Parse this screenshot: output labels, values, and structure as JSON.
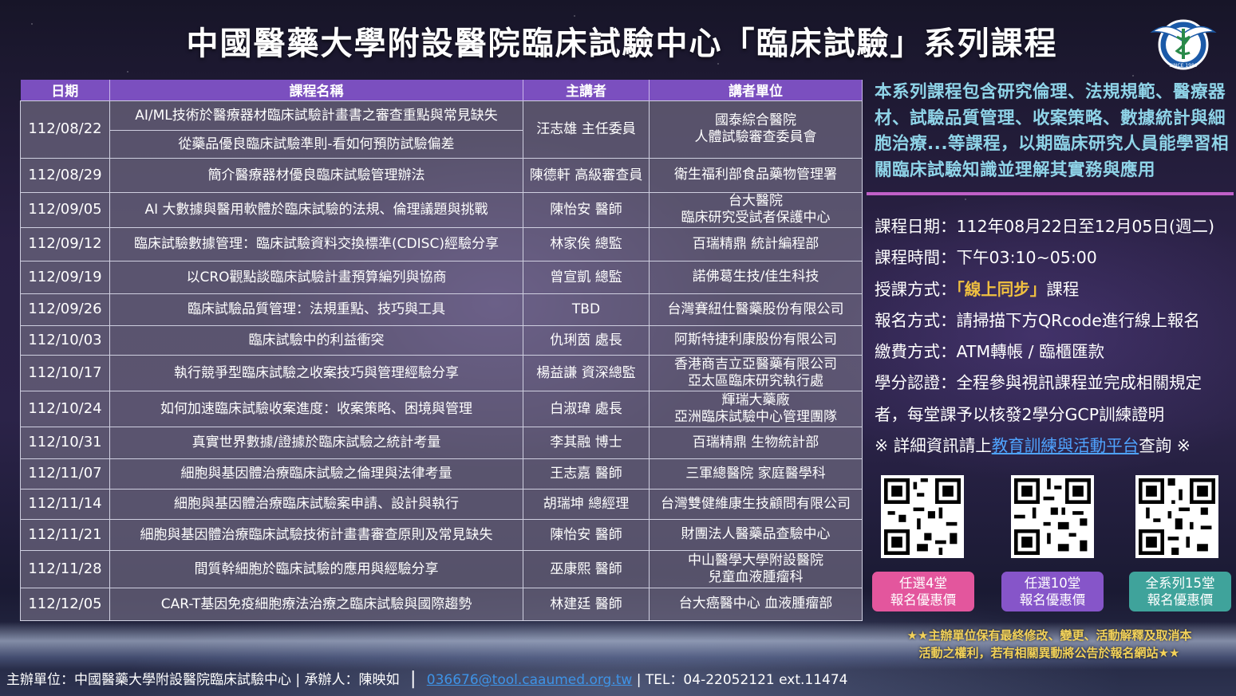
{
  "title": "中國醫藥大學附設醫院臨床試驗中心「臨床試驗」系列課程",
  "logo_text": "SINCE 1980",
  "table": {
    "headers": [
      "日期",
      "課程名稱",
      "主講者",
      "講者單位"
    ],
    "rows": [
      {
        "date": "112/08/22",
        "course": "AI/ML技術於醫療器材臨床試驗計畫書之審查重點與常見缺失",
        "course2": "從藥品優良臨床試驗準則-看如何預防試驗偏差",
        "speaker": "汪志雄 主任委員",
        "unit1": "國泰綜合醫院",
        "unit2": "人體試驗審查委員會"
      },
      {
        "date": "112/08/29",
        "course": "簡介醫療器材優良臨床試驗管理辦法",
        "speaker": "陳德軒 高級審查員",
        "unit1": "衛生福利部食品藥物管理署"
      },
      {
        "date": "112/09/05",
        "course": "AI 大數據與醫用軟體於臨床試驗的法規、倫理議題與挑戰",
        "speaker": "陳怡安 醫師",
        "unit1": "台大醫院",
        "unit2": "臨床研究受試者保護中心"
      },
      {
        "date": "112/09/12",
        "course": "臨床試驗數據管理：臨床試驗資料交換標準(CDISC)經驗分享",
        "speaker": "林家俟 總監",
        "unit1": "百瑞精鼎 統計編程部"
      },
      {
        "date": "112/09/19",
        "course": "以CRO觀點談臨床試驗計畫預算編列與協商",
        "speaker": "曾宣凱 總監",
        "unit1": "諾佛葛生技/佳生科技"
      },
      {
        "date": "112/09/26",
        "course": "臨床試驗品質管理：法規重點、技巧與工具",
        "speaker": "TBD",
        "unit1": "台灣賽紐仕醫藥股份有限公司"
      },
      {
        "date": "112/10/03",
        "course": "臨床試驗中的利益衝突",
        "speaker": "仇琍茵 處長",
        "unit1": "阿斯特捷利康股份有限公司"
      },
      {
        "date": "112/10/17",
        "course": "執行競爭型臨床試驗之收案技巧與管理經驗分享",
        "speaker": "楊益謙 資深總監",
        "unit1": "香港商吉立亞醫藥有限公司",
        "unit2": "亞太區臨床研究執行處"
      },
      {
        "date": "112/10/24",
        "course": "如何加速臨床試驗收案進度：收案策略、困境與管理",
        "speaker": "白淑瑋 處長",
        "unit1": "輝瑞大藥廠",
        "unit2": "亞洲臨床試驗中心管理團隊"
      },
      {
        "date": "112/10/31",
        "course": "真實世界數據/證據於臨床試驗之統計考量",
        "speaker": "李其融 博士",
        "unit1": "百瑞精鼎 生物統計部"
      },
      {
        "date": "112/11/07",
        "course": "細胞與基因體治療臨床試驗之倫理與法律考量",
        "speaker": "王志嘉 醫師",
        "unit1": "三軍總醫院 家庭醫學科"
      },
      {
        "date": "112/11/14",
        "course": "細胞與基因體治療臨床試驗案申請、設計與執行",
        "speaker": "胡瑞坤 總經理",
        "unit1": "台灣雙健維康生技顧問有限公司"
      },
      {
        "date": "112/11/21",
        "course": "細胞與基因體治療臨床試驗技術計畫書審查原則及常見缺失",
        "speaker": "陳怡安 醫師",
        "unit1": "財團法人醫藥品查驗中心"
      },
      {
        "date": "112/11/28",
        "course": "間質幹細胞於臨床試驗的應用與經驗分享",
        "speaker": "巫康熙 醫師",
        "unit1": "中山醫學大學附設醫院",
        "unit2": "兒童血液腫瘤科"
      },
      {
        "date": "112/12/05",
        "course": "CAR-T基因免疫細胞療法治療之臨床試驗與國際趨勢",
        "speaker": "林建廷 醫師",
        "unit1": "台大癌醫中心 血液腫瘤部"
      }
    ]
  },
  "intro": "本系列課程包含研究倫理、法規規範、醫療器材、試驗品質管理、收案策略、數據統計與細胞治療...等課程，以期臨床研究人員能學習相關臨床試驗知識並理解其實務與應用",
  "info": {
    "date": "課程日期：112年08月22日至12月05日(週二)",
    "time": "課程時間：下午03:10~05:00",
    "mode_prefix": "授課方式：",
    "mode_highlight": "「線上同步」",
    "mode_suffix": "課程",
    "register": "報名方式：請掃描下方QRcode進行線上報名",
    "payment": "繳費方式：ATM轉帳 / 臨櫃匯款",
    "credit_line1": "學分認證：全程參與視訊課程並完成相關規定",
    "credit_line2": "者，每堂課予以核發2學分GCP訓練證明",
    "detail_prefix": "※ 詳細資訊請上",
    "detail_link": "教育訓練與活動平台",
    "detail_suffix": "查詢 ※"
  },
  "badges": [
    {
      "line1": "任選4堂",
      "line2": "報名優惠價",
      "color": "#e3569d"
    },
    {
      "line1": "任選10堂",
      "line2": "報名優惠價",
      "color": "#8655c9"
    },
    {
      "line1": "全系列15堂",
      "line2": "報名優惠價",
      "color": "#3fa39b"
    }
  ],
  "notice": {
    "line1": "★★主辦單位保有最終修改、變更、活動解釋及取消本",
    "line2": "活動之權利，若有相關異動將公告於報名網站★★"
  },
  "footer": {
    "organizer": "主辦單位：中國醫藥大學附設醫院臨床試驗中心 | 承辦人：陳映如",
    "email": "036676@tool.caaumed.org.tw",
    "tel": "| TEL：04-22052121 ext.11474"
  }
}
